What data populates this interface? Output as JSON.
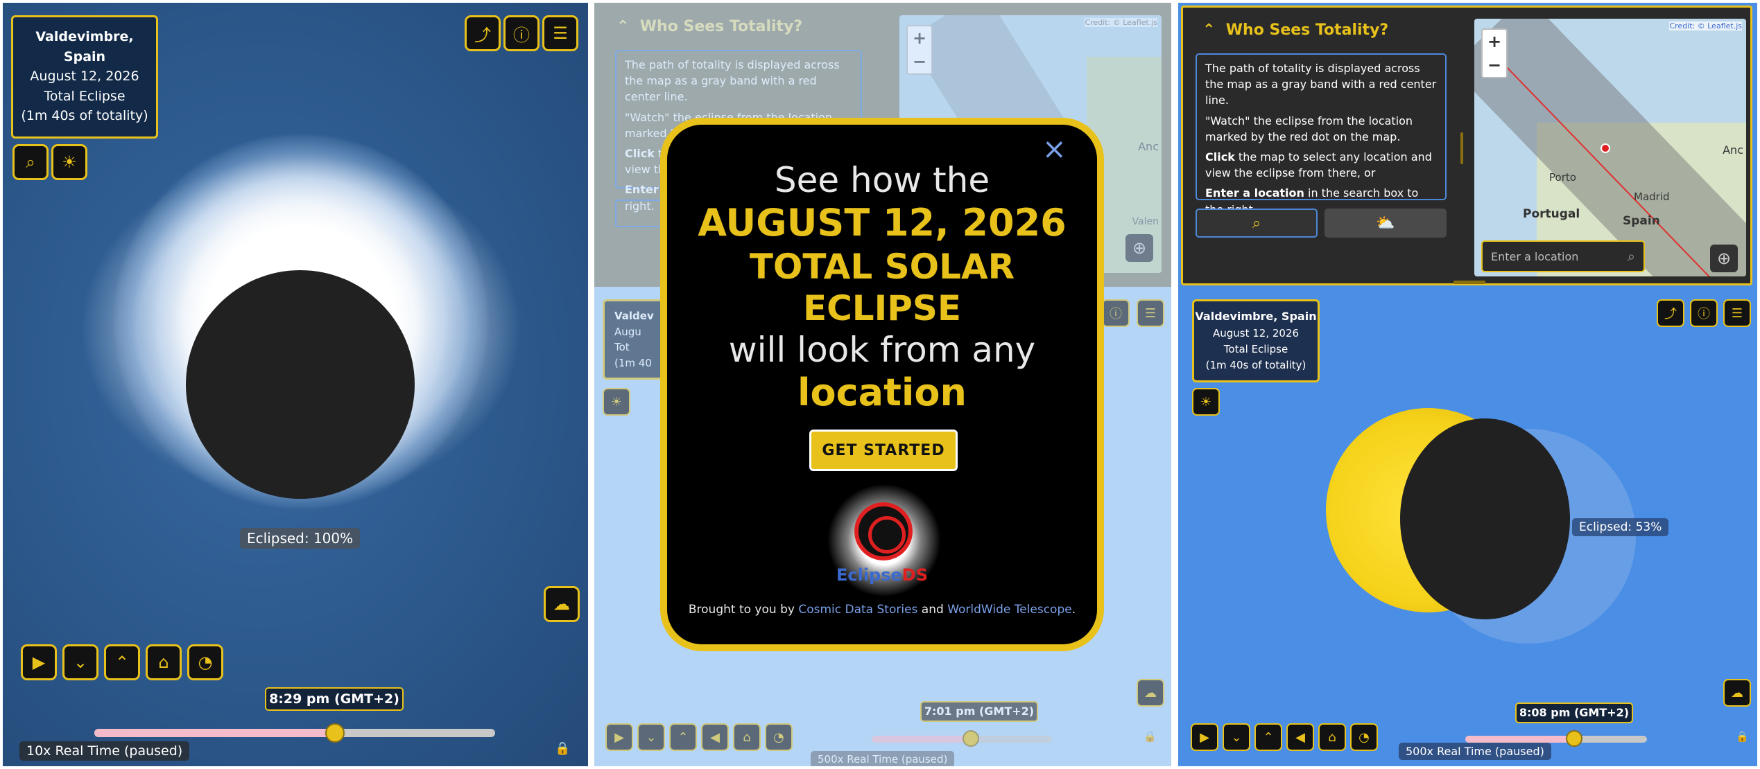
{
  "panel1": {
    "location_lines": [
      "Valdevimbre,",
      "Spain"
    ],
    "date": "August 12, 2026",
    "eclipse_type": "Total Eclipse",
    "totality": "(1m 40s of totality)",
    "eclipsed_label": "Eclipsed: 100%",
    "time": "8:29 pm (GMT+2)",
    "speed": "10x Real Time (paused)",
    "slider_fraction": 0.6
  },
  "panel2": {
    "section_title": "Who Sees Totality?",
    "desc_p1": "The path of totality is displayed across the map as a gray band with a red center line.",
    "desc_p2": "\"Watch\" the eclipse from the location marked by the red dot on the map.",
    "desc_p3_bold": "Click",
    "desc_p3_rest": " th",
    "desc_p3b": "view th",
    "desc_p4_bold": "Enter",
    "desc_p4b": "right.",
    "map_credit": "Credit: © Leaflet.js",
    "zoom_in": "+",
    "zoom_out": "−",
    "map_label_an": "Anc",
    "map_label_val": "Valen",
    "info_title": "Valdev",
    "info_line2": "Augu",
    "info_line3": "Tot",
    "info_line4": "(1m 40",
    "modal": {
      "line1": "See how the",
      "line2": "AUGUST 12, 2026",
      "line3": "TOTAL SOLAR ECLIPSE",
      "line4": "will look from any",
      "line5": "location",
      "button": "GET STARTED",
      "logo_text_a": "Eclipse",
      "logo_text_b": "DS",
      "credit_prefix": "Brought to you by ",
      "credit_link1": "Cosmic Data Stories",
      "credit_mid": " and ",
      "credit_link2": "WorldWide Telescope",
      "credit_end": "."
    },
    "time": "7:01 pm (GMT+2)",
    "speed": "500x Real Time (paused)",
    "slider_fraction": 0.55
  },
  "panel3": {
    "section_title": "Who Sees Totality?",
    "desc_p1": "The path of totality is displayed across the map as a gray band with a red center line.",
    "desc_p2": "\"Watch\" the eclipse from the location marked by the red dot on the map.",
    "desc_p3_bold": "Click",
    "desc_p3_rest": " the map to select any location and view the eclipse from there, or",
    "desc_p4_bold": "Enter a location",
    "desc_p4_rest": " in the search box to the right.",
    "map_credit": "Credit: © Leaflet.js",
    "zoom_in": "+",
    "zoom_out": "−",
    "map_labels": {
      "porto": "Porto",
      "portugal": "Portugal",
      "madrid": "Madrid",
      "spain": "Spain",
      "an": "Anc"
    },
    "search_placeholder": "Enter a location",
    "info_title": "Valdevimbre, Spain",
    "date": "August 12, 2026",
    "eclipse_type": "Total Eclipse",
    "totality": "(1m 40s of totality)",
    "eclipsed_label": "Eclipsed: 53%",
    "time": "8:08 pm (GMT+2)",
    "speed": "500x Real Time (paused)",
    "slider_fraction": 0.6
  },
  "colors": {
    "accent": "#e8c21b",
    "panel_dark": "#121212",
    "link": "#7aa0e8"
  }
}
